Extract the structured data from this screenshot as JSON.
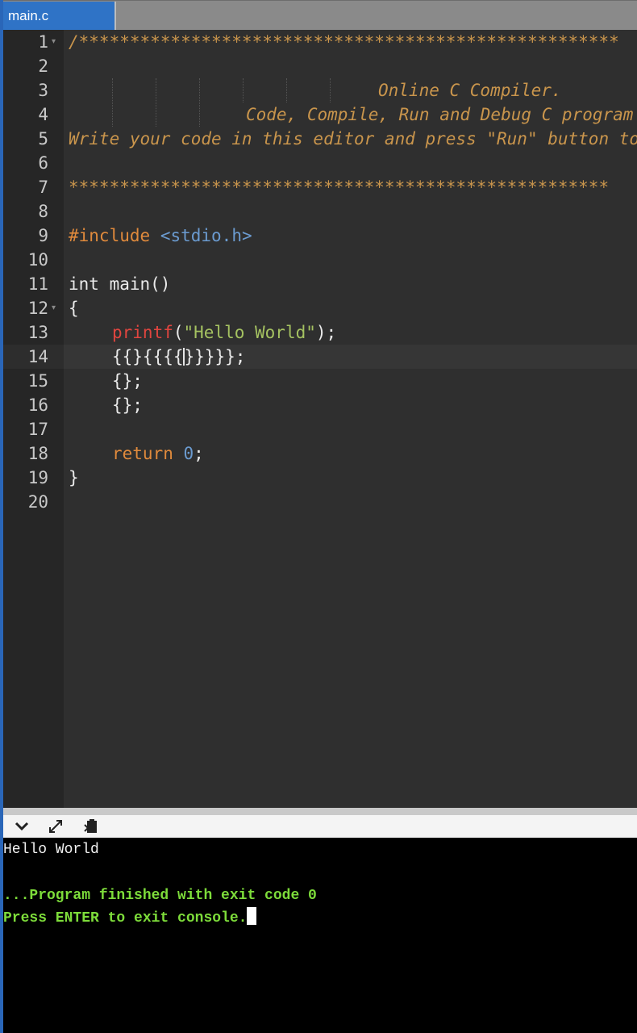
{
  "tab": {
    "title": "main.c"
  },
  "editor": {
    "line_numbers": [
      "1",
      "2",
      "3",
      "4",
      "5",
      "6",
      "7",
      "8",
      "9",
      "10",
      "11",
      "12",
      "13",
      "14",
      "15",
      "16",
      "17",
      "18",
      "19",
      "20"
    ],
    "line1": "/*****************************************************",
    "line3": "Online C Compiler.",
    "line4": "Code, Compile, Run and Debug C program online.",
    "line5": "Write your code in this editor and press \"Run\" button to compile and execute it.",
    "line7": "*****************************************************",
    "line9": {
      "directive": "#include",
      "header": "<stdio.h>"
    },
    "line11": "int main()",
    "line12": "{",
    "line13": {
      "fn": "printf",
      "open": "(",
      "str": "\"Hello World\"",
      "close": ");"
    },
    "line14": {
      "before": "{{}{{{{",
      "after": "}}}}};"
    },
    "line15": "{};",
    "line16": "{};",
    "line18": {
      "kw": "return",
      "num": "0",
      "end": ";"
    },
    "line19": "}"
  },
  "console": {
    "output": "Hello World",
    "finished": "...Program finished with exit code 0",
    "prompt": "Press ENTER to exit console."
  },
  "icons": {
    "collapse": "chevron-down-icon",
    "expand": "expand-arrows-icon",
    "copy": "clipboard-copy-icon"
  }
}
